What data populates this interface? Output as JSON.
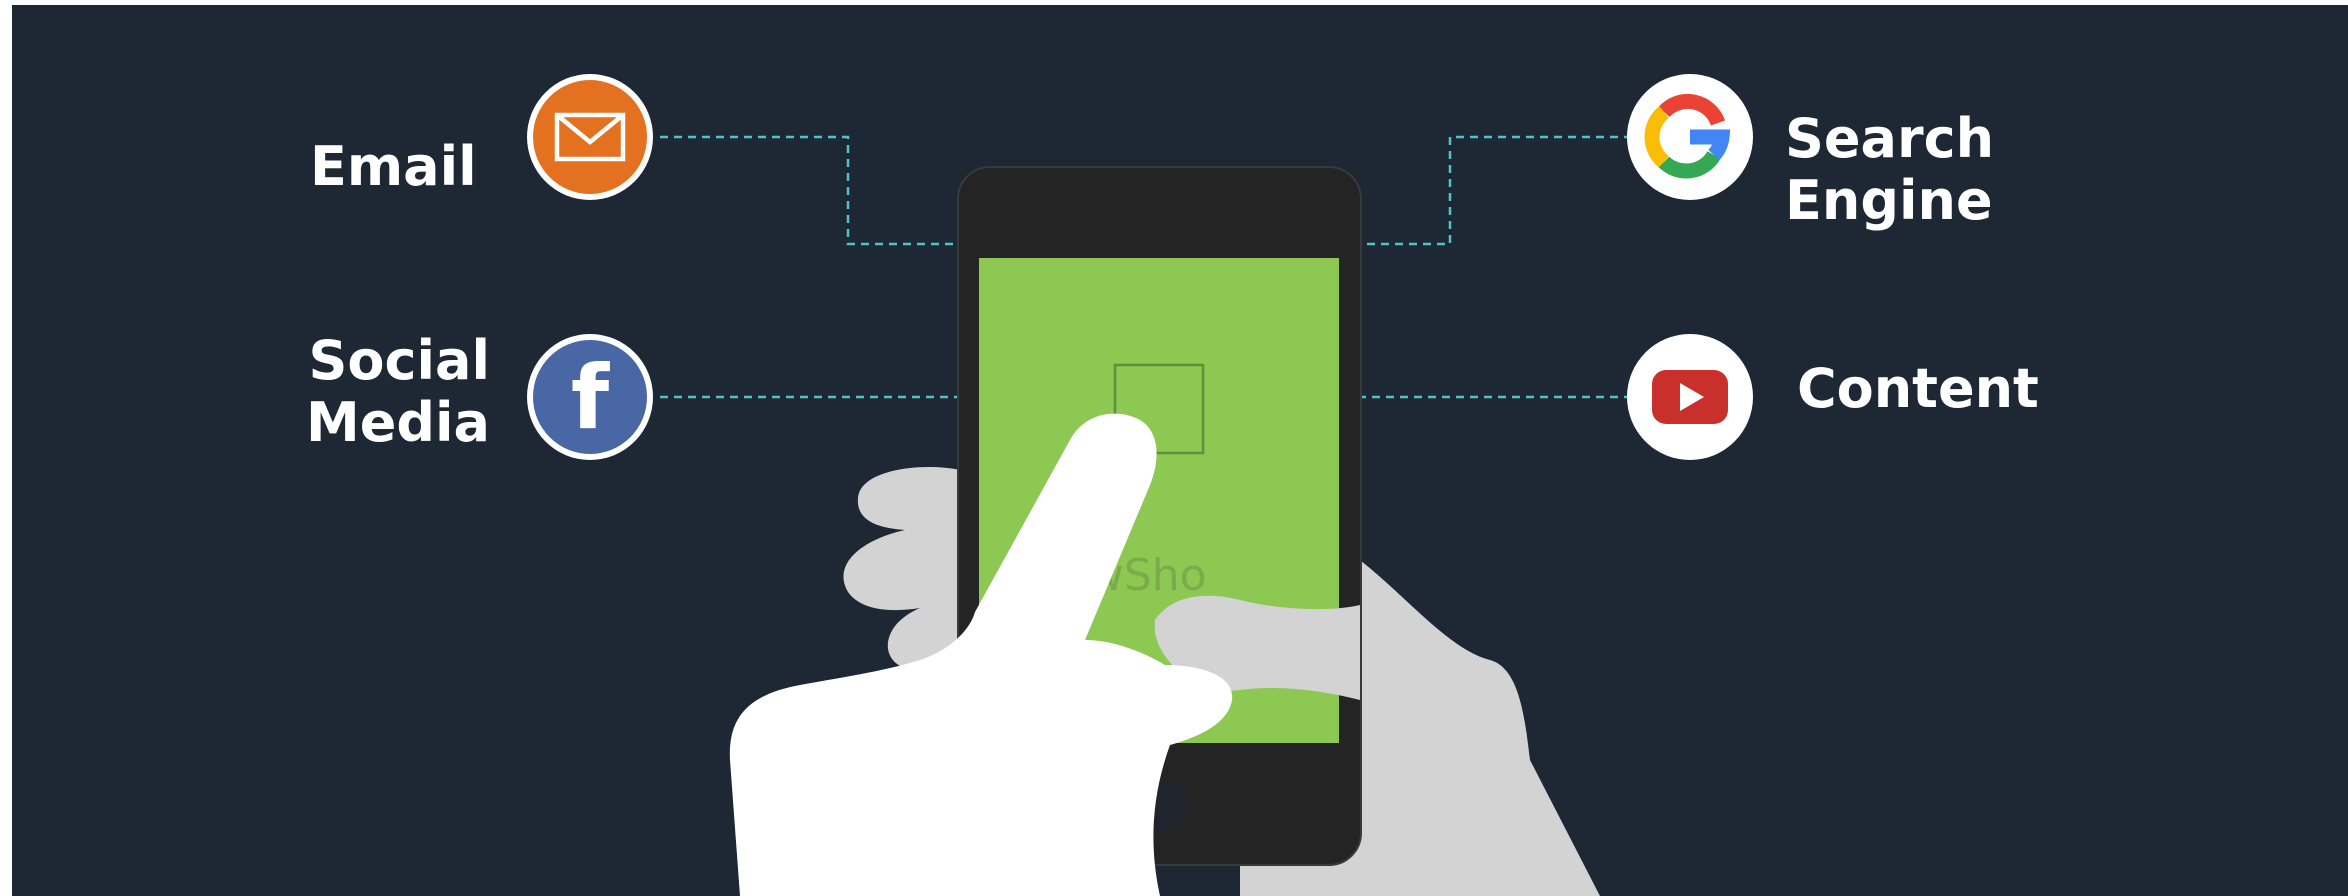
{
  "channels": {
    "email": {
      "label": "Email",
      "icon": "envelope-icon",
      "color": "#e4711f"
    },
    "social_media": {
      "lines": [
        "Social",
        "Media"
      ],
      "icon": "facebook-icon",
      "color": "#4a67a5"
    },
    "search_engine": {
      "lines": [
        "Search",
        "Engine"
      ],
      "icon": "google-icon"
    },
    "content": {
      "label": "Content",
      "icon": "youtube-icon",
      "color": "#c9302c"
    }
  },
  "phone": {
    "screen_color": "#8dc853",
    "watermark": "WowSho"
  },
  "colors": {
    "background": "#1e2734",
    "connector": "#4fc3c9",
    "hand_front": "#ffffff",
    "hand_back": "#d3d3d3"
  }
}
